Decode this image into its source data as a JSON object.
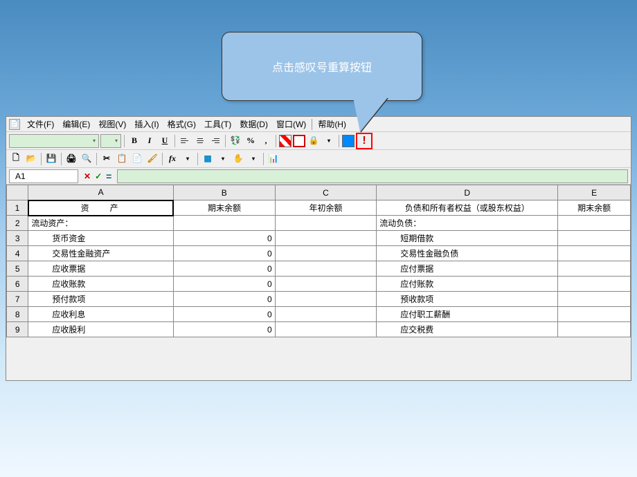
{
  "callout": {
    "text": "点击感叹号重算按钮"
  },
  "menubar": {
    "items": [
      "文件(F)",
      "编辑(E)",
      "视图(V)",
      "插入(I)",
      "格式(G)",
      "工具(T)",
      "数据(D)",
      "窗口(W)",
      "帮助(H)"
    ]
  },
  "cell_ref": "A1",
  "formula_icons": {
    "cancel": "✕",
    "confirm": "✓",
    "equals": "="
  },
  "columns": [
    "A",
    "B",
    "C",
    "D",
    "E"
  ],
  "sheet": {
    "header": {
      "a": "资产",
      "b": "期末余额",
      "c": "年初余额",
      "d": "负债和所有者权益（或股东权益）",
      "e": "期末余额"
    },
    "rows": [
      {
        "n": "2",
        "a": "流动资产：",
        "b": "",
        "c": "",
        "d": "流动负债：",
        "ai": 0,
        "di": 0
      },
      {
        "n": "3",
        "a": "货币资金",
        "b": "0",
        "c": "",
        "d": "短期借款",
        "ai": 2,
        "di": 2
      },
      {
        "n": "4",
        "a": "交易性金融资产",
        "b": "0",
        "c": "",
        "d": "交易性金融负债",
        "ai": 2,
        "di": 2
      },
      {
        "n": "5",
        "a": "应收票据",
        "b": "0",
        "c": "",
        "d": "应付票据",
        "ai": 2,
        "di": 2
      },
      {
        "n": "6",
        "a": "应收账款",
        "b": "0",
        "c": "",
        "d": "应付账款",
        "ai": 2,
        "di": 2
      },
      {
        "n": "7",
        "a": "预付款项",
        "b": "0",
        "c": "",
        "d": "预收款项",
        "ai": 2,
        "di": 2
      },
      {
        "n": "8",
        "a": "应收利息",
        "b": "0",
        "c": "",
        "d": "应付职工薪酬",
        "ai": 2,
        "di": 2
      },
      {
        "n": "9",
        "a": "应收股利",
        "b": "0",
        "c": "",
        "d": "应交税费",
        "ai": 2,
        "di": 2
      }
    ]
  },
  "chart_data": {
    "type": "table",
    "title": "资产负债表",
    "columns": [
      "资产",
      "期末余额",
      "年初余额",
      "负债和所有者权益（或股东权益）",
      "期末余额"
    ],
    "rows": [
      [
        "流动资产：",
        "",
        "",
        "流动负债：",
        ""
      ],
      [
        "货币资金",
        0,
        "",
        "短期借款",
        ""
      ],
      [
        "交易性金融资产",
        0,
        "",
        "交易性金融负债",
        ""
      ],
      [
        "应收票据",
        0,
        "",
        "应付票据",
        ""
      ],
      [
        "应收账款",
        0,
        "",
        "应付账款",
        ""
      ],
      [
        "预付款项",
        0,
        "",
        "预收款项",
        ""
      ],
      [
        "应收利息",
        0,
        "",
        "应付职工薪酬",
        ""
      ],
      [
        "应收股利",
        0,
        "",
        "应交税费",
        ""
      ]
    ]
  }
}
